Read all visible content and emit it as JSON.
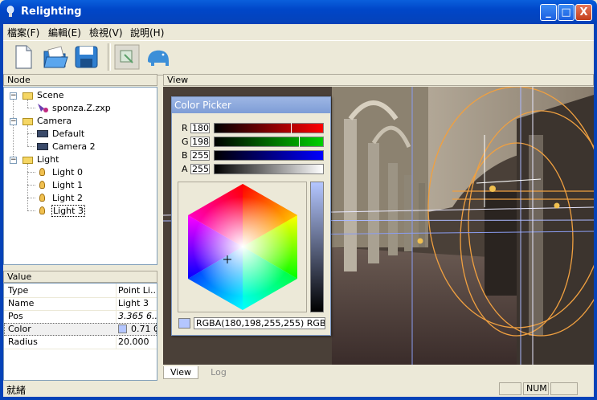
{
  "window": {
    "title": "Relighting",
    "minimize_label": "_",
    "maximize_label": "□",
    "close_label": "X"
  },
  "menu": {
    "items": [
      "檔案(F)",
      "編輯(E)",
      "檢視(V)",
      "說明(H)"
    ]
  },
  "toolbar": {
    "tools": [
      "new-file-icon",
      "open-folder-icon",
      "save-icon",
      "render-icon",
      "elephant-icon"
    ]
  },
  "node_panel": {
    "header": "Node",
    "tree": {
      "scene": "Scene",
      "scene_file": "sponza.Z.zxp",
      "camera": "Camera",
      "camera_default": "Default",
      "camera_2": "Camera 2",
      "light": "Light",
      "light_0": "Light 0",
      "light_1": "Light 1",
      "light_2": "Light 2",
      "light_3": "Light 3"
    }
  },
  "value_panel": {
    "header": "Value",
    "rows": [
      {
        "label": "Type",
        "value": "Point Li..."
      },
      {
        "label": "Name",
        "value": "Light 3"
      },
      {
        "label": "Pos",
        "value": "3.365 6...."
      },
      {
        "label": "Color",
        "value": "0.71 0..."
      },
      {
        "label": "Radius",
        "value": "20.000"
      }
    ],
    "color_swatch": "#b4c6ff"
  },
  "view_panel": {
    "header": "View",
    "tabs": [
      "View",
      "Log"
    ]
  },
  "color_picker": {
    "title": "Color Picker",
    "channels": [
      {
        "label": "R",
        "value": "180",
        "fraction": 0.706,
        "color": "#ff0000"
      },
      {
        "label": "G",
        "value": "198",
        "fraction": 0.776,
        "color": "#00d000"
      },
      {
        "label": "B",
        "value": "255",
        "fraction": 1.0,
        "color": "#0000ff"
      },
      {
        "label": "A",
        "value": "255",
        "fraction": 1.0,
        "color": "#ffffff"
      }
    ],
    "current_color": "#b4c6ff",
    "readout": "RGBA(180,198,255,255) RGB(180,198,255)"
  },
  "status": {
    "text": "就緒",
    "indicator": "NUM"
  }
}
